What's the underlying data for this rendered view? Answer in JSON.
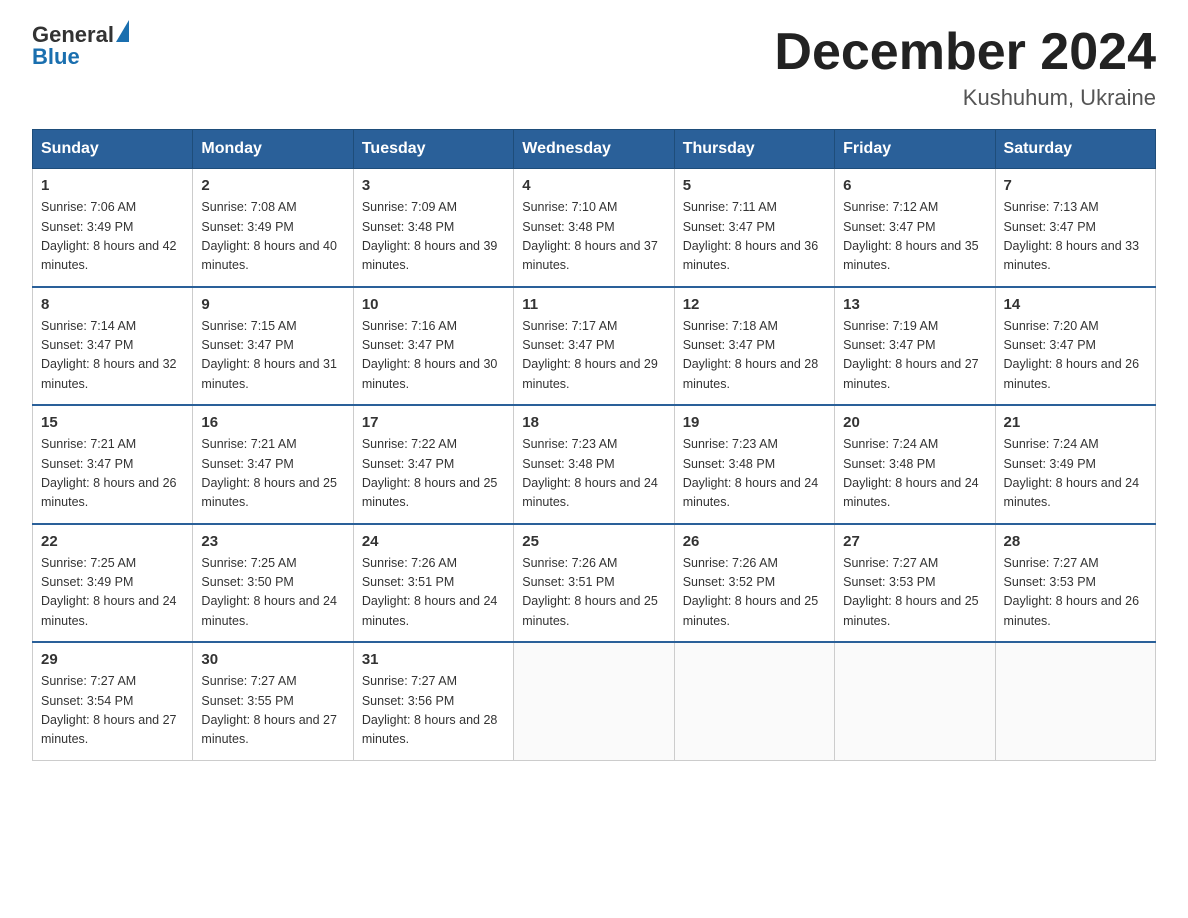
{
  "logo": {
    "general": "General",
    "blue": "Blue"
  },
  "title": {
    "month": "December 2024",
    "location": "Kushuhum, Ukraine"
  },
  "weekdays": [
    "Sunday",
    "Monday",
    "Tuesday",
    "Wednesday",
    "Thursday",
    "Friday",
    "Saturday"
  ],
  "weeks": [
    [
      {
        "day": "1",
        "sunrise": "7:06 AM",
        "sunset": "3:49 PM",
        "daylight": "8 hours and 42 minutes."
      },
      {
        "day": "2",
        "sunrise": "7:08 AM",
        "sunset": "3:49 PM",
        "daylight": "8 hours and 40 minutes."
      },
      {
        "day": "3",
        "sunrise": "7:09 AM",
        "sunset": "3:48 PM",
        "daylight": "8 hours and 39 minutes."
      },
      {
        "day": "4",
        "sunrise": "7:10 AM",
        "sunset": "3:48 PM",
        "daylight": "8 hours and 37 minutes."
      },
      {
        "day": "5",
        "sunrise": "7:11 AM",
        "sunset": "3:47 PM",
        "daylight": "8 hours and 36 minutes."
      },
      {
        "day": "6",
        "sunrise": "7:12 AM",
        "sunset": "3:47 PM",
        "daylight": "8 hours and 35 minutes."
      },
      {
        "day": "7",
        "sunrise": "7:13 AM",
        "sunset": "3:47 PM",
        "daylight": "8 hours and 33 minutes."
      }
    ],
    [
      {
        "day": "8",
        "sunrise": "7:14 AM",
        "sunset": "3:47 PM",
        "daylight": "8 hours and 32 minutes."
      },
      {
        "day": "9",
        "sunrise": "7:15 AM",
        "sunset": "3:47 PM",
        "daylight": "8 hours and 31 minutes."
      },
      {
        "day": "10",
        "sunrise": "7:16 AM",
        "sunset": "3:47 PM",
        "daylight": "8 hours and 30 minutes."
      },
      {
        "day": "11",
        "sunrise": "7:17 AM",
        "sunset": "3:47 PM",
        "daylight": "8 hours and 29 minutes."
      },
      {
        "day": "12",
        "sunrise": "7:18 AM",
        "sunset": "3:47 PM",
        "daylight": "8 hours and 28 minutes."
      },
      {
        "day": "13",
        "sunrise": "7:19 AM",
        "sunset": "3:47 PM",
        "daylight": "8 hours and 27 minutes."
      },
      {
        "day": "14",
        "sunrise": "7:20 AM",
        "sunset": "3:47 PM",
        "daylight": "8 hours and 26 minutes."
      }
    ],
    [
      {
        "day": "15",
        "sunrise": "7:21 AM",
        "sunset": "3:47 PM",
        "daylight": "8 hours and 26 minutes."
      },
      {
        "day": "16",
        "sunrise": "7:21 AM",
        "sunset": "3:47 PM",
        "daylight": "8 hours and 25 minutes."
      },
      {
        "day": "17",
        "sunrise": "7:22 AM",
        "sunset": "3:47 PM",
        "daylight": "8 hours and 25 minutes."
      },
      {
        "day": "18",
        "sunrise": "7:23 AM",
        "sunset": "3:48 PM",
        "daylight": "8 hours and 24 minutes."
      },
      {
        "day": "19",
        "sunrise": "7:23 AM",
        "sunset": "3:48 PM",
        "daylight": "8 hours and 24 minutes."
      },
      {
        "day": "20",
        "sunrise": "7:24 AM",
        "sunset": "3:48 PM",
        "daylight": "8 hours and 24 minutes."
      },
      {
        "day": "21",
        "sunrise": "7:24 AM",
        "sunset": "3:49 PM",
        "daylight": "8 hours and 24 minutes."
      }
    ],
    [
      {
        "day": "22",
        "sunrise": "7:25 AM",
        "sunset": "3:49 PM",
        "daylight": "8 hours and 24 minutes."
      },
      {
        "day": "23",
        "sunrise": "7:25 AM",
        "sunset": "3:50 PM",
        "daylight": "8 hours and 24 minutes."
      },
      {
        "day": "24",
        "sunrise": "7:26 AM",
        "sunset": "3:51 PM",
        "daylight": "8 hours and 24 minutes."
      },
      {
        "day": "25",
        "sunrise": "7:26 AM",
        "sunset": "3:51 PM",
        "daylight": "8 hours and 25 minutes."
      },
      {
        "day": "26",
        "sunrise": "7:26 AM",
        "sunset": "3:52 PM",
        "daylight": "8 hours and 25 minutes."
      },
      {
        "day": "27",
        "sunrise": "7:27 AM",
        "sunset": "3:53 PM",
        "daylight": "8 hours and 25 minutes."
      },
      {
        "day": "28",
        "sunrise": "7:27 AM",
        "sunset": "3:53 PM",
        "daylight": "8 hours and 26 minutes."
      }
    ],
    [
      {
        "day": "29",
        "sunrise": "7:27 AM",
        "sunset": "3:54 PM",
        "daylight": "8 hours and 27 minutes."
      },
      {
        "day": "30",
        "sunrise": "7:27 AM",
        "sunset": "3:55 PM",
        "daylight": "8 hours and 27 minutes."
      },
      {
        "day": "31",
        "sunrise": "7:27 AM",
        "sunset": "3:56 PM",
        "daylight": "8 hours and 28 minutes."
      },
      null,
      null,
      null,
      null
    ]
  ]
}
